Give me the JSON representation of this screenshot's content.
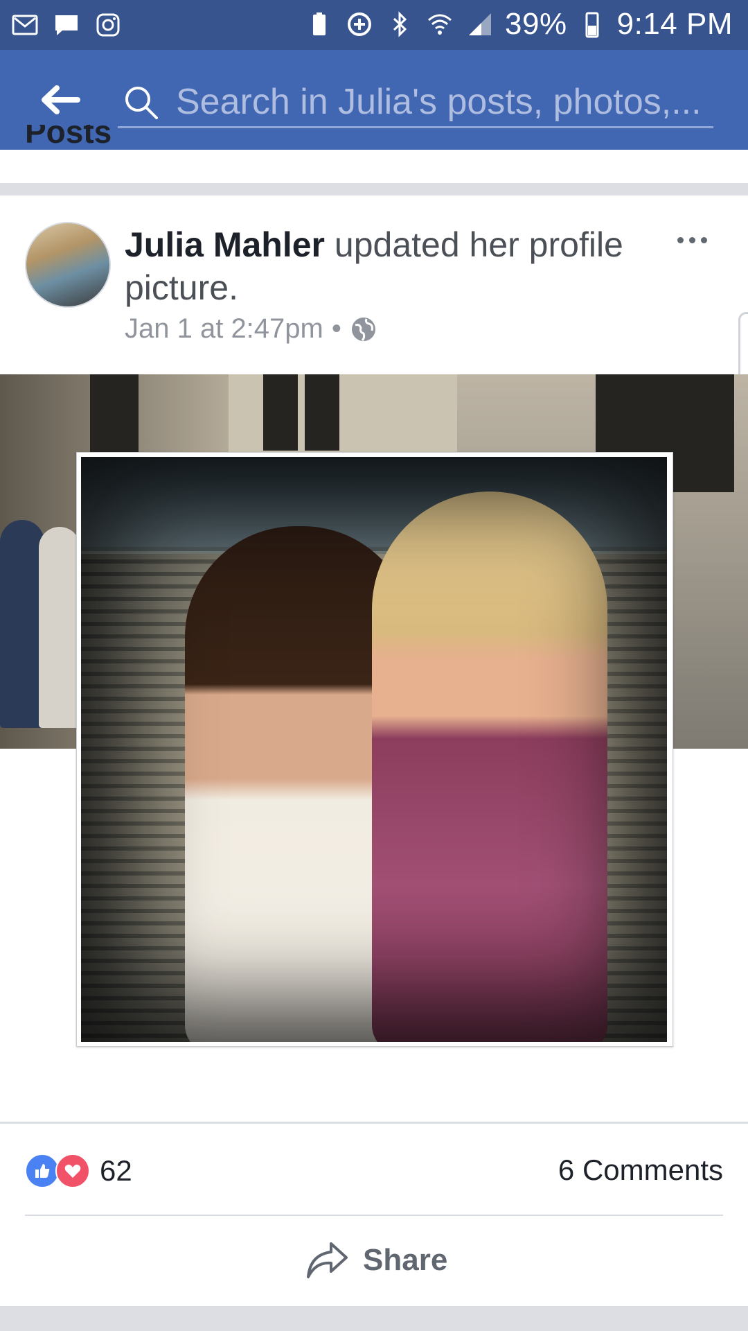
{
  "status_bar": {
    "battery": "39%",
    "time": "9:14 PM"
  },
  "header": {
    "search_placeholder": "Search in Julia's posts, photos,..."
  },
  "section": {
    "title_remnant": "Posts"
  },
  "post": {
    "author": "Julia Mahler",
    "action": " updated her profile picture.",
    "timestamp": "Jan 1 at 2:47pm",
    "separator": "•",
    "privacy_icon": "globe-icon",
    "reaction_count": "62",
    "comments": "6 Comments",
    "share_label": "Share"
  },
  "colors": {
    "brand": "#4267b2",
    "status_bar": "#37548f",
    "like": "#4a81f3",
    "love": "#f25268"
  }
}
